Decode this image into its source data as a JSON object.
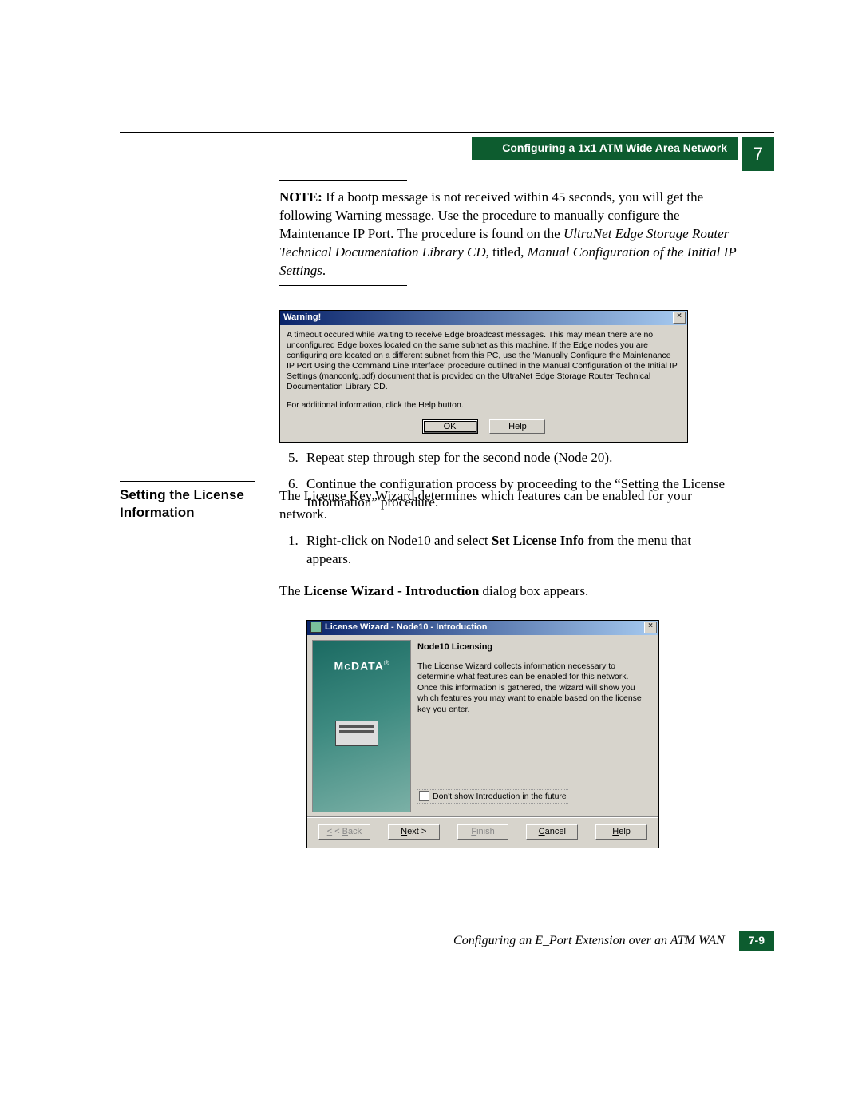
{
  "header": {
    "section_title": "Configuring a 1x1 ATM Wide Area Network",
    "chapter_number": "7"
  },
  "note": {
    "label": "NOTE:",
    "body_plain_before_italic": "If a bootp message is not received within 45 seconds, you will get the following Warning message. Use the procedure to manually configure the Maintenance IP Port. The procedure is found on the ",
    "italic1": "UltraNet Edge Storage Router Technical Documentation Library CD",
    "mid": ", titled, ",
    "italic2": "Manual Configuration of the Initial IP Settings",
    "tail": "."
  },
  "warning_dialog": {
    "title": "Warning!",
    "body": "A timeout occured while waiting to receive Edge broadcast messages. This may mean there are no unconfigured Edge boxes located on the same subnet as this machine. If the Edge nodes you are configuring are located on a different subnet from this PC, use the 'Manually Configure the Maintenance IP Port Using the Command Line Interface' procedure outlined in the Manual Configuration of the Initial IP Settings (manconfg.pdf) document that is provided on the UltraNet Edge Storage Router Technical Documentation Library CD.",
    "body2": "For additional information, click the Help button.",
    "ok": "OK",
    "help": "Help"
  },
  "steps_after_warning": {
    "s5": "Repeat step  through step  for the second node (Node 20).",
    "s6": "Continue the configuration process by proceeding to the “Setting the License Information” procedure."
  },
  "section": {
    "heading": "Setting the License Information",
    "intro": "The License Key Wizard determines which features can be enabled for your network.",
    "step1_before_bold": "Right-click on Node10 and select ",
    "step1_bold": "Set License Info",
    "step1_after_bold": " from the menu that appears.",
    "step1_result_before_bold": "The ",
    "step1_result_bold": "License Wizard - Introduction",
    "step1_result_after_bold": " dialog box appears."
  },
  "wizard": {
    "title": "License Wizard - Node10 - Introduction",
    "brand": "McDATA",
    "right_title": "Node10 Licensing",
    "right_text": "The License Wizard collects information necessary to determine what features can be enabled for this network. Once this information is gathered, the wizard will show you which features you may want to enable based on the license key you enter.",
    "checkbox_label": "Don't show Introduction in the future",
    "btn_back": "< Back",
    "btn_next": "Next >",
    "btn_finish": "Finish",
    "btn_cancel": "Cancel",
    "btn_help": "Help"
  },
  "footer": {
    "title": "Configuring an E_Port Extension over an ATM WAN",
    "page": "7-9"
  }
}
